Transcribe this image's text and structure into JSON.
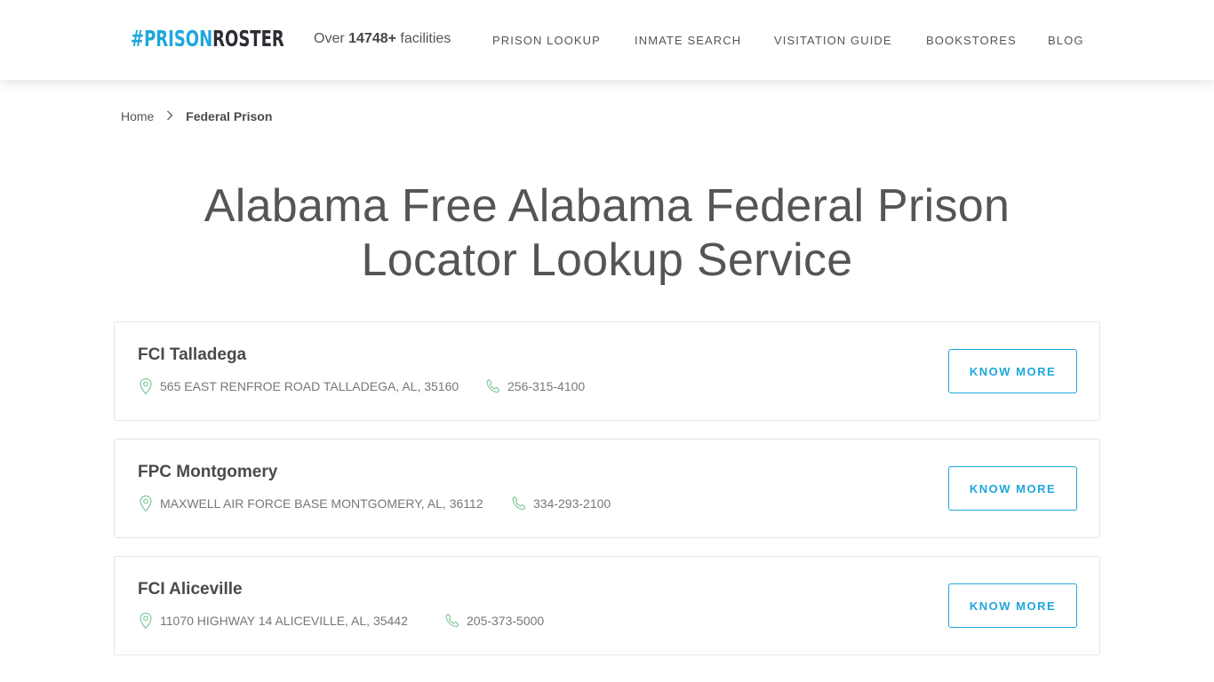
{
  "header": {
    "logo": {
      "hash": "#PRISON",
      "rest": "ROSTER"
    },
    "tagline": {
      "prefix": "Over ",
      "count": "14748+",
      "suffix": " facilities"
    },
    "nav": [
      {
        "label": "PRISON LOOKUP"
      },
      {
        "label": "INMATE SEARCH"
      },
      {
        "label": "VISITATION GUIDE"
      },
      {
        "label": "BOOKSTORES"
      },
      {
        "label": "BLOG"
      }
    ]
  },
  "breadcrumb": {
    "home": "Home",
    "separator": "›",
    "current": "Federal Prison"
  },
  "page": {
    "title": "Alabama Free Alabama Federal Prison Locator Lookup Service"
  },
  "facilities": [
    {
      "name": "FCI Talladega",
      "address": "565 EAST RENFROE ROAD TALLADEGA, AL, 35160",
      "phone": "256-315-4100",
      "button": "KNOW MORE"
    },
    {
      "name": "FPC Montgomery",
      "address": "MAXWELL AIR FORCE BASE MONTGOMERY, AL, 36112",
      "phone": "334-293-2100",
      "button": "KNOW MORE"
    },
    {
      "name": "FCI Aliceville",
      "address": "11070 HIGHWAY 14 ALICEVILLE, AL, 35442",
      "phone": "205-373-5000",
      "button": "KNOW MORE"
    }
  ],
  "colors": {
    "accent": "#1ea7dc",
    "icon_green": "#7dc89a",
    "text": "#555555"
  }
}
